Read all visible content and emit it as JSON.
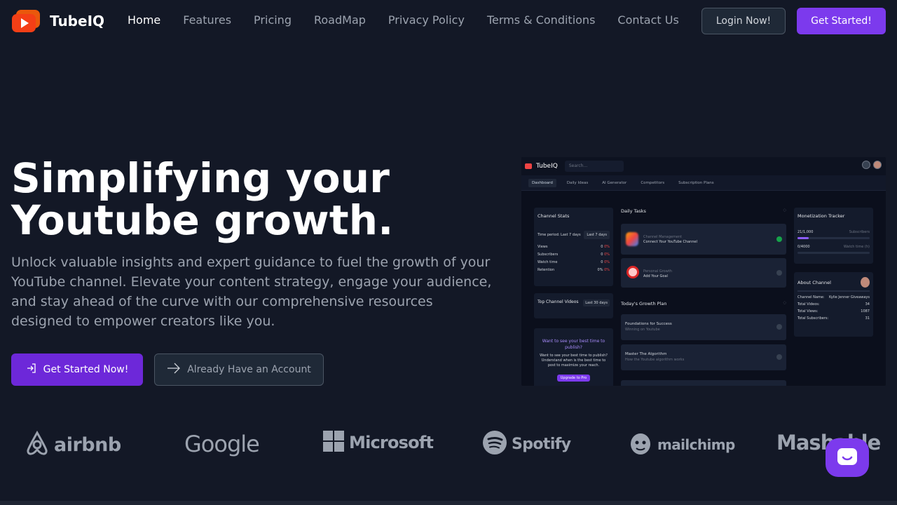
{
  "brand": {
    "name": "TubeIQ"
  },
  "nav": {
    "links": [
      {
        "label": "Home",
        "active": true
      },
      {
        "label": "Features"
      },
      {
        "label": "Pricing"
      },
      {
        "label": "RoadMap"
      },
      {
        "label": "Privacy Policy"
      },
      {
        "label": "Terms & Conditions"
      },
      {
        "label": "Contact Us"
      }
    ],
    "login_label": "Login Now!",
    "get_started_label": "Get Started!"
  },
  "hero": {
    "title_line1": "Simplifying your",
    "title_line2": "Youtube growth.",
    "subtitle": "Unlock valuable insights and expert guidance to fuel the growth of your YouTube channel. Elevate your content strategy, engage your audience, and stay ahead of the curve with our comprehensive resources designed to empower creators like you.",
    "primary_cta": "Get Started Now!",
    "secondary_cta": "Already Have an Account"
  },
  "preview": {
    "brand": "TubeIQ",
    "search_placeholder": "Search...",
    "tabs": [
      "Dashboard",
      "Daily Ideas",
      "AI Generator",
      "Competitors",
      "Subscription Plans"
    ],
    "channel_stats": {
      "title": "Channel Stats",
      "period_label": "Time period: Last 7 days",
      "period_select": "Last 7 days",
      "rows": [
        {
          "label": "Views",
          "value": "0",
          "delta": "0%"
        },
        {
          "label": "Subscribers",
          "value": "0",
          "delta": "0%"
        },
        {
          "label": "Watch time",
          "value": "0",
          "delta": "0%"
        },
        {
          "label": "Retention",
          "value": "0%",
          "delta": "0%"
        }
      ]
    },
    "top_videos": {
      "title": "Top Channel Videos",
      "period": "Last 30 days"
    },
    "best_time": {
      "title": "Want to see your best time to publish?",
      "body": "Want to see your best time to publish? Understand when is the best time to post to maximize your reach.",
      "button": "Upgrade to Pro"
    },
    "daily_tasks": {
      "title": "Daily Tasks",
      "items": [
        {
          "category": "Channel Management",
          "name": "Connect Your YouTube Channel",
          "done": true
        },
        {
          "category": "Personal Growth",
          "name": "Add Your Goal",
          "done": false
        }
      ]
    },
    "growth_plan": {
      "title": "Today's Growth Plan",
      "items": [
        {
          "name": "Foundations for Success",
          "desc": "Winning on Youtube"
        },
        {
          "name": "Master The Algorithm",
          "desc": "How the Youtube algorithm works"
        }
      ]
    },
    "monetization": {
      "title": "Monetization Tracker",
      "subs_value": "21",
      "subs_goal": "/1,000",
      "subs_label": "Subscribers",
      "subs_progress": 0.021,
      "watch_value": "0",
      "watch_goal": "/4000",
      "watch_label": "Watch time (h)",
      "watch_progress": 0
    },
    "about": {
      "title": "About Channel",
      "rows": [
        {
          "label": "Channel Name:",
          "value": "Kylie Jenner Giveaways"
        },
        {
          "label": "Total Videos:",
          "value": "34"
        },
        {
          "label": "Total Views:",
          "value": "1087"
        },
        {
          "label": "Total Subscribers:",
          "value": "31"
        }
      ]
    }
  },
  "logos": [
    "airbnb",
    "Google",
    "Microsoft",
    "Spotify",
    "mailchimp",
    "Mashable"
  ]
}
